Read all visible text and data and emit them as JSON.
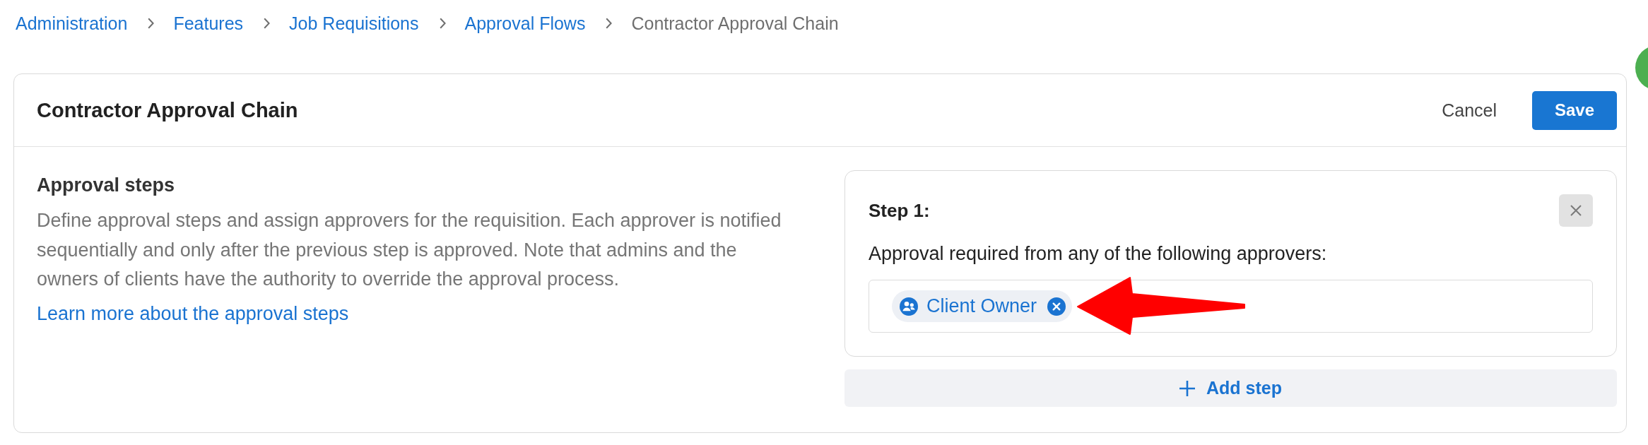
{
  "breadcrumb": [
    {
      "label": "Administration",
      "current": false
    },
    {
      "label": "Features",
      "current": false
    },
    {
      "label": "Job Requisitions",
      "current": false
    },
    {
      "label": "Approval Flows",
      "current": false
    },
    {
      "label": "Contractor Approval Chain",
      "current": true
    }
  ],
  "editor": {
    "title": "Contractor Approval Chain",
    "actions": [
      {
        "label": "Cancel",
        "kind": "secondary"
      },
      {
        "label": "Save",
        "kind": "primary"
      }
    ],
    "info": {
      "heading": "Approval steps",
      "description": "Define approval steps and assign approvers for the requisition. Each approver is notified sequentially and only after the previous step is approved. Note that admins and the owners of clients have the authority to override the approval process.",
      "link": "Learn more about the approval steps"
    },
    "steps": [
      {
        "title": "Step 1:",
        "prompt": "Approval required from any of the following approvers:",
        "approvers": [
          {
            "label": "Client Owner"
          }
        ]
      }
    ],
    "add_step": "Add step"
  }
}
